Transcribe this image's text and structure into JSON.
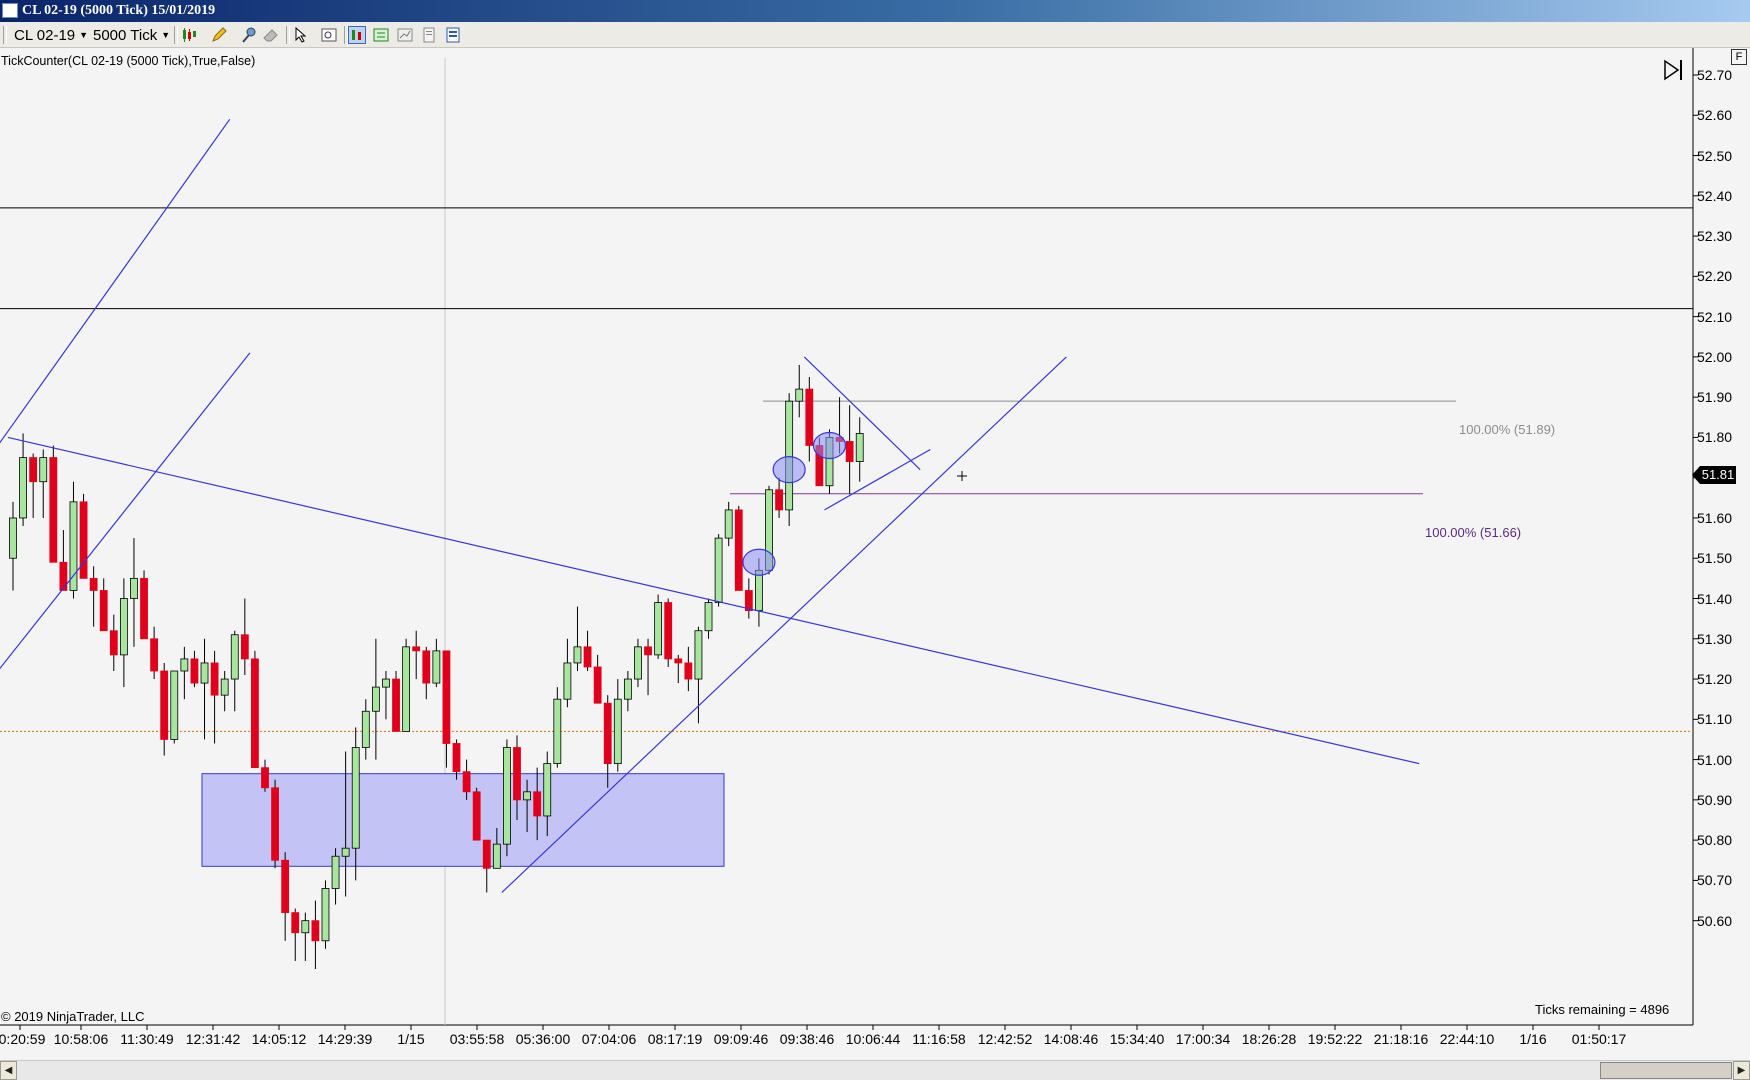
{
  "window": {
    "title": "CL 02-19 (5000 Tick)  15/01/2019"
  },
  "toolbar": {
    "instrument": "CL 02-19",
    "interval": "5000 Tick"
  },
  "indicator_label": "TickCounter(CL  02-19  (5000  Tick),True,False)",
  "copyright": "© 2019 NinjaTrader, LLC",
  "ticks_remaining": "Ticks remaining = 4896",
  "last_price": "51.81",
  "f_button": "F",
  "fib_upper_label": "100.00% (51.89)",
  "fib_lower_label": "100.00% (51.66)",
  "colors": {
    "up": "#a8e6a0",
    "down": "#e0001b",
    "trendline": "#3636d9",
    "zone_fill": "#c3c3f5",
    "zone_stroke": "#3636d9",
    "fib_lower": "#7d3c98"
  },
  "icons": [
    "chart-icon",
    "dropdown-arrow-icon",
    "candles-icon",
    "pencil-icon",
    "pin-icon",
    "eraser-icon",
    "cursor-icon",
    "magnifier-icon",
    "bar-style-icon",
    "data-box-icon",
    "properties-icon",
    "template-icon",
    "end-of-chart-icon",
    "scroll-left-icon",
    "scroll-right-icon"
  ],
  "chart_data": {
    "type": "candlestick",
    "y_labels": [
      "52.70",
      "52.60",
      "52.50",
      "52.40",
      "52.30",
      "52.20",
      "52.10",
      "52.00",
      "51.90",
      "51.80",
      "51.70",
      "51.60",
      "51.50",
      "51.40",
      "51.30",
      "51.20",
      "51.10",
      "51.00",
      "50.90",
      "50.80",
      "50.70",
      "50.60"
    ],
    "ylim": [
      50.59,
      52.72
    ],
    "x_labels": [
      "0:20:59",
      "10:58:06",
      "11:30:49",
      "12:31:42",
      "14:05:12",
      "14:29:39",
      "1/15",
      "03:55:58",
      "05:36:00",
      "07:04:06",
      "08:17:19",
      "09:09:46",
      "09:38:46",
      "10:06:44",
      "11:16:58",
      "12:42:52",
      "14:08:46",
      "15:34:40",
      "17:00:34",
      "18:26:28",
      "19:52:22",
      "21:18:16",
      "22:44:10",
      "1/16",
      "01:50:17"
    ],
    "horizontal_lines": [
      52.37,
      52.12
    ],
    "current_price_line": 51.07,
    "fib_levels": [
      51.89,
      51.66
    ],
    "zone": {
      "price_top": 50.965,
      "price_bottom": 50.735
    },
    "candles": [
      {
        "o": 51.5,
        "h": 51.64,
        "l": 51.42,
        "c": 51.6
      },
      {
        "o": 51.6,
        "h": 51.81,
        "l": 51.58,
        "c": 51.75
      },
      {
        "o": 51.75,
        "h": 51.76,
        "l": 51.6,
        "c": 51.69
      },
      {
        "o": 51.69,
        "h": 51.77,
        "l": 51.6,
        "c": 51.75
      },
      {
        "o": 51.75,
        "h": 51.78,
        "l": 51.52,
        "c": 51.49
      },
      {
        "o": 51.49,
        "h": 51.57,
        "l": 51.42,
        "c": 51.42
      },
      {
        "o": 51.42,
        "h": 51.69,
        "l": 51.4,
        "c": 51.64
      },
      {
        "o": 51.64,
        "h": 51.66,
        "l": 51.48,
        "c": 51.45
      },
      {
        "o": 51.45,
        "h": 51.48,
        "l": 51.33,
        "c": 51.42
      },
      {
        "o": 51.42,
        "h": 51.45,
        "l": 51.35,
        "c": 51.32
      },
      {
        "o": 51.32,
        "h": 51.36,
        "l": 51.22,
        "c": 51.26
      },
      {
        "o": 51.26,
        "h": 51.45,
        "l": 51.18,
        "c": 51.4
      },
      {
        "o": 51.4,
        "h": 51.55,
        "l": 51.28,
        "c": 51.45
      },
      {
        "o": 51.45,
        "h": 51.47,
        "l": 51.35,
        "c": 51.3
      },
      {
        "o": 51.3,
        "h": 51.33,
        "l": 51.2,
        "c": 51.22
      },
      {
        "o": 51.22,
        "h": 51.24,
        "l": 51.01,
        "c": 51.05
      },
      {
        "o": 51.05,
        "h": 51.22,
        "l": 51.04,
        "c": 51.22
      },
      {
        "o": 51.22,
        "h": 51.28,
        "l": 51.15,
        "c": 51.25
      },
      {
        "o": 51.25,
        "h": 51.27,
        "l": 51.18,
        "c": 51.19
      },
      {
        "o": 51.19,
        "h": 51.3,
        "l": 51.05,
        "c": 51.24
      },
      {
        "o": 51.24,
        "h": 51.27,
        "l": 51.04,
        "c": 51.16
      },
      {
        "o": 51.16,
        "h": 51.22,
        "l": 51.12,
        "c": 51.2
      },
      {
        "o": 51.2,
        "h": 51.32,
        "l": 51.12,
        "c": 51.31
      },
      {
        "o": 51.31,
        "h": 51.4,
        "l": 51.21,
        "c": 51.25
      },
      {
        "o": 51.25,
        "h": 51.27,
        "l": 51.02,
        "c": 50.98
      },
      {
        "o": 50.98,
        "h": 51.0,
        "l": 50.92,
        "c": 50.93
      },
      {
        "o": 50.93,
        "h": 50.95,
        "l": 50.73,
        "c": 50.75
      },
      {
        "o": 50.75,
        "h": 50.77,
        "l": 50.55,
        "c": 50.62
      },
      {
        "o": 50.62,
        "h": 50.63,
        "l": 50.5,
        "c": 50.57
      },
      {
        "o": 50.57,
        "h": 50.62,
        "l": 50.5,
        "c": 50.6
      },
      {
        "o": 50.6,
        "h": 50.65,
        "l": 50.48,
        "c": 50.55
      },
      {
        "o": 50.55,
        "h": 50.7,
        "l": 50.53,
        "c": 50.68
      },
      {
        "o": 50.68,
        "h": 50.78,
        "l": 50.64,
        "c": 50.76
      },
      {
        "o": 50.76,
        "h": 51.02,
        "l": 50.66,
        "c": 50.78
      },
      {
        "o": 50.78,
        "h": 51.08,
        "l": 50.7,
        "c": 51.03
      },
      {
        "o": 51.03,
        "h": 51.15,
        "l": 51.0,
        "c": 51.12
      },
      {
        "o": 51.12,
        "h": 51.3,
        "l": 51.0,
        "c": 51.18
      },
      {
        "o": 51.18,
        "h": 51.22,
        "l": 51.1,
        "c": 51.2
      },
      {
        "o": 51.2,
        "h": 51.22,
        "l": 51.07,
        "c": 51.07
      },
      {
        "o": 51.07,
        "h": 51.3,
        "l": 51.07,
        "c": 51.28
      },
      {
        "o": 51.28,
        "h": 51.32,
        "l": 51.2,
        "c": 51.27
      },
      {
        "o": 51.27,
        "h": 51.28,
        "l": 51.15,
        "c": 51.19
      },
      {
        "o": 51.19,
        "h": 51.3,
        "l": 51.18,
        "c": 51.27
      },
      {
        "o": 51.27,
        "h": 51.27,
        "l": 50.98,
        "c": 51.04
      },
      {
        "o": 51.04,
        "h": 51.05,
        "l": 50.95,
        "c": 50.97
      },
      {
        "o": 50.97,
        "h": 51.0,
        "l": 50.9,
        "c": 50.92
      },
      {
        "o": 50.92,
        "h": 50.93,
        "l": 50.8,
        "c": 50.8
      },
      {
        "o": 50.8,
        "h": 50.8,
        "l": 50.67,
        "c": 50.73
      },
      {
        "o": 50.73,
        "h": 50.83,
        "l": 50.73,
        "c": 50.79
      },
      {
        "o": 50.79,
        "h": 51.05,
        "l": 50.76,
        "c": 51.03
      },
      {
        "o": 51.03,
        "h": 51.06,
        "l": 50.85,
        "c": 50.9
      },
      {
        "o": 50.9,
        "h": 50.95,
        "l": 50.82,
        "c": 50.92
      },
      {
        "o": 50.92,
        "h": 50.98,
        "l": 50.8,
        "c": 50.86
      },
      {
        "o": 50.86,
        "h": 51.02,
        "l": 50.81,
        "c": 50.99
      },
      {
        "o": 50.99,
        "h": 51.18,
        "l": 50.98,
        "c": 51.15
      },
      {
        "o": 51.15,
        "h": 51.3,
        "l": 51.13,
        "c": 51.24
      },
      {
        "o": 51.24,
        "h": 51.38,
        "l": 51.22,
        "c": 51.28
      },
      {
        "o": 51.28,
        "h": 51.32,
        "l": 51.22,
        "c": 51.23
      },
      {
        "o": 51.23,
        "h": 51.26,
        "l": 51.14,
        "c": 51.14
      },
      {
        "o": 51.14,
        "h": 51.16,
        "l": 50.93,
        "c": 50.99
      },
      {
        "o": 50.99,
        "h": 51.2,
        "l": 50.97,
        "c": 51.15
      },
      {
        "o": 51.15,
        "h": 51.22,
        "l": 51.12,
        "c": 51.2
      },
      {
        "o": 51.2,
        "h": 51.3,
        "l": 51.18,
        "c": 51.28
      },
      {
        "o": 51.28,
        "h": 51.3,
        "l": 51.16,
        "c": 51.26
      },
      {
        "o": 51.26,
        "h": 51.41,
        "l": 51.25,
        "c": 51.39
      },
      {
        "o": 51.39,
        "h": 51.4,
        "l": 51.23,
        "c": 51.25
      },
      {
        "o": 51.25,
        "h": 51.26,
        "l": 51.19,
        "c": 51.24
      },
      {
        "o": 51.24,
        "h": 51.28,
        "l": 51.17,
        "c": 51.2
      },
      {
        "o": 51.2,
        "h": 51.33,
        "l": 51.09,
        "c": 51.32
      },
      {
        "o": 51.32,
        "h": 51.4,
        "l": 51.3,
        "c": 51.39
      },
      {
        "o": 51.39,
        "h": 51.56,
        "l": 51.38,
        "c": 51.55
      },
      {
        "o": 51.55,
        "h": 51.64,
        "l": 51.53,
        "c": 51.62
      },
      {
        "o": 51.62,
        "h": 51.63,
        "l": 51.5,
        "c": 51.42
      },
      {
        "o": 51.42,
        "h": 51.45,
        "l": 51.35,
        "c": 51.37
      },
      {
        "o": 51.37,
        "h": 51.5,
        "l": 51.33,
        "c": 51.47
      },
      {
        "o": 51.47,
        "h": 51.68,
        "l": 51.46,
        "c": 51.67
      },
      {
        "o": 51.67,
        "h": 51.7,
        "l": 51.6,
        "c": 51.62
      },
      {
        "o": 51.62,
        "h": 51.91,
        "l": 51.58,
        "c": 51.89
      },
      {
        "o": 51.89,
        "h": 51.98,
        "l": 51.85,
        "c": 51.92
      },
      {
        "o": 51.92,
        "h": 51.95,
        "l": 51.74,
        "c": 51.78
      },
      {
        "o": 51.78,
        "h": 51.8,
        "l": 51.69,
        "c": 51.68
      },
      {
        "o": 51.68,
        "h": 51.82,
        "l": 51.66,
        "c": 51.8
      },
      {
        "o": 51.8,
        "h": 51.9,
        "l": 51.76,
        "c": 51.79
      },
      {
        "o": 51.79,
        "h": 51.88,
        "l": 51.66,
        "c": 51.74
      },
      {
        "o": 51.74,
        "h": 51.85,
        "l": 51.69,
        "c": 51.81
      }
    ],
    "trendlines": [
      {
        "t1": -0.5,
        "p1": 51.8,
        "t2": 139.5,
        "p2": 50.99
      },
      {
        "t1": -1.5,
        "p1": 51.78,
        "t2": 21.5,
        "p2": 52.59
      },
      {
        "t1": -1.5,
        "p1": 51.22,
        "t2": 23.5,
        "p2": 52.01
      },
      {
        "t1": 48.5,
        "p1": 50.67,
        "t2": 104.5,
        "p2": 52.0
      },
      {
        "t1": 78.5,
        "p1": 52.0,
        "t2": 90,
        "p2": 51.72
      },
      {
        "t1": 80.5,
        "p1": 51.62,
        "t2": 91,
        "p2": 51.77
      }
    ],
    "ellipses": [
      {
        "t": 74,
        "p": 51.49
      },
      {
        "t": 77,
        "p": 51.72
      },
      {
        "t": 81,
        "p": 51.78
      }
    ]
  }
}
